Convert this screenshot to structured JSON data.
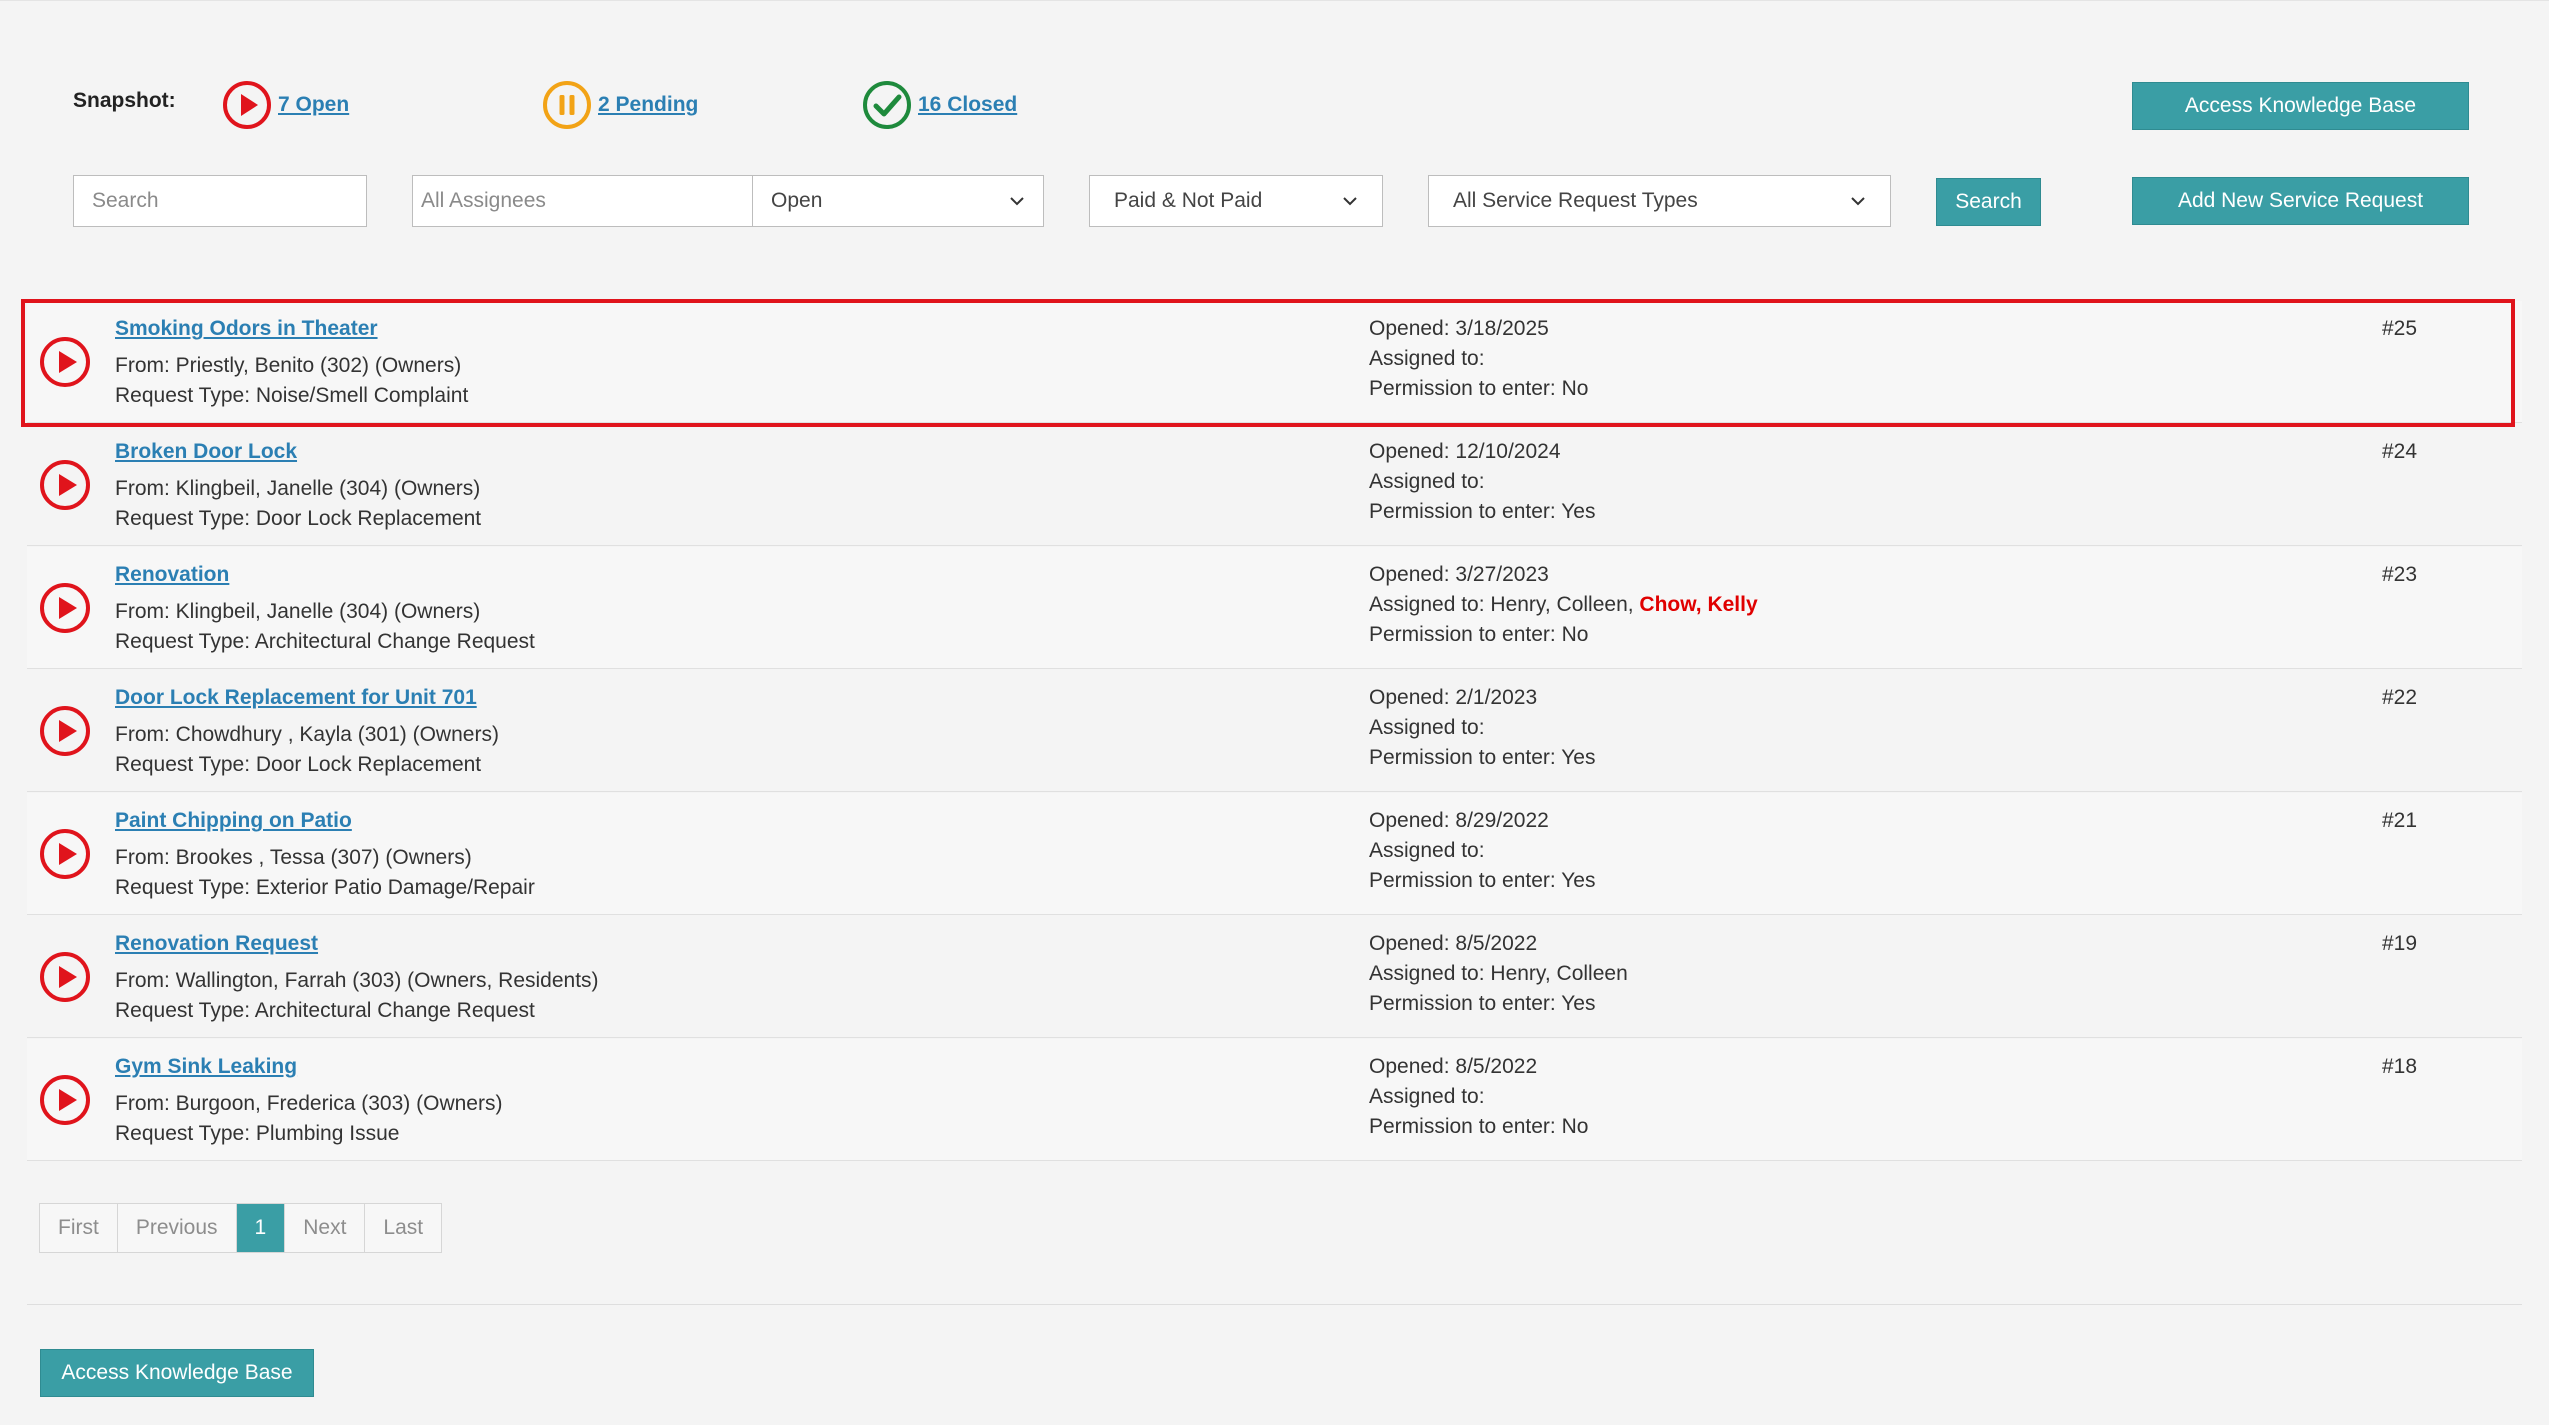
{
  "snapshot": {
    "label": "Snapshot:",
    "open": "7 Open",
    "pending": "2 Pending",
    "closed": "16 Closed"
  },
  "buttons": {
    "kb_top": "Access Knowledge Base",
    "add_new": "Add New Service Request",
    "search": "Search",
    "kb_bottom": "Access Knowledge Base"
  },
  "filters": {
    "search_placeholder": "Search",
    "assignees_placeholder": "All Assignees",
    "status": "Open",
    "paid": "Paid & Not Paid",
    "types": "All Service Request Types"
  },
  "requests": [
    {
      "title": "Smoking Odors in Theater",
      "from": "From: Priestly, Benito (302) (Owners)",
      "type": "Request Type: Noise/Smell Complaint",
      "opened": "Opened: 3/18/2025",
      "assigned": "Assigned to:",
      "assigned_extra": "",
      "permission": "Permission to enter: No",
      "number": "#25"
    },
    {
      "title": "Broken Door Lock",
      "from": "From: Klingbeil, Janelle (304) (Owners)",
      "type": "Request Type: Door Lock Replacement",
      "opened": "Opened: 12/10/2024",
      "assigned": "Assigned to:",
      "assigned_extra": "",
      "permission": "Permission to enter: Yes",
      "number": "#24"
    },
    {
      "title": "Renovation",
      "from": "From: Klingbeil, Janelle (304) (Owners)",
      "type": "Request Type: Architectural Change Request",
      "opened": "Opened: 3/27/2023",
      "assigned": "Assigned to: Henry, Colleen, ",
      "assigned_extra": "Chow, Kelly",
      "permission": "Permission to enter: No",
      "number": "#23"
    },
    {
      "title": "Door Lock Replacement for Unit 701",
      "from": "From: Chowdhury , Kayla (301) (Owners)",
      "type": "Request Type: Door Lock Replacement",
      "opened": "Opened: 2/1/2023",
      "assigned": "Assigned to:",
      "assigned_extra": "",
      "permission": "Permission to enter: Yes",
      "number": "#22"
    },
    {
      "title": "Paint Chipping on Patio",
      "from": "From: Brookes , Tessa (307) (Owners)",
      "type": "Request Type: Exterior Patio Damage/Repair",
      "opened": "Opened: 8/29/2022",
      "assigned": "Assigned to:",
      "assigned_extra": "",
      "permission": "Permission to enter: Yes",
      "number": "#21"
    },
    {
      "title": "Renovation Request",
      "from": "From: Wallington, Farrah (303) (Owners, Residents)",
      "type": "Request Type: Architectural Change Request",
      "opened": "Opened: 8/5/2022",
      "assigned": "Assigned to: Henry, Colleen",
      "assigned_extra": "",
      "permission": "Permission to enter: Yes",
      "number": "#19"
    },
    {
      "title": "Gym Sink Leaking",
      "from": "From: Burgoon, Frederica (303) (Owners)",
      "type": "Request Type: Plumbing Issue",
      "opened": "Opened: 8/5/2022",
      "assigned": "Assigned to:",
      "assigned_extra": "",
      "permission": "Permission to enter: No",
      "number": "#18"
    }
  ],
  "pagination": {
    "first": "First",
    "previous": "Previous",
    "current": "1",
    "next": "Next",
    "last": "Last"
  },
  "colors": {
    "accent": "#3a9ea5",
    "link": "#2b7fb3",
    "open": "#e0141c",
    "pending": "#f2a316",
    "closed": "#1e8a3c",
    "highlight": "#e0141c"
  }
}
